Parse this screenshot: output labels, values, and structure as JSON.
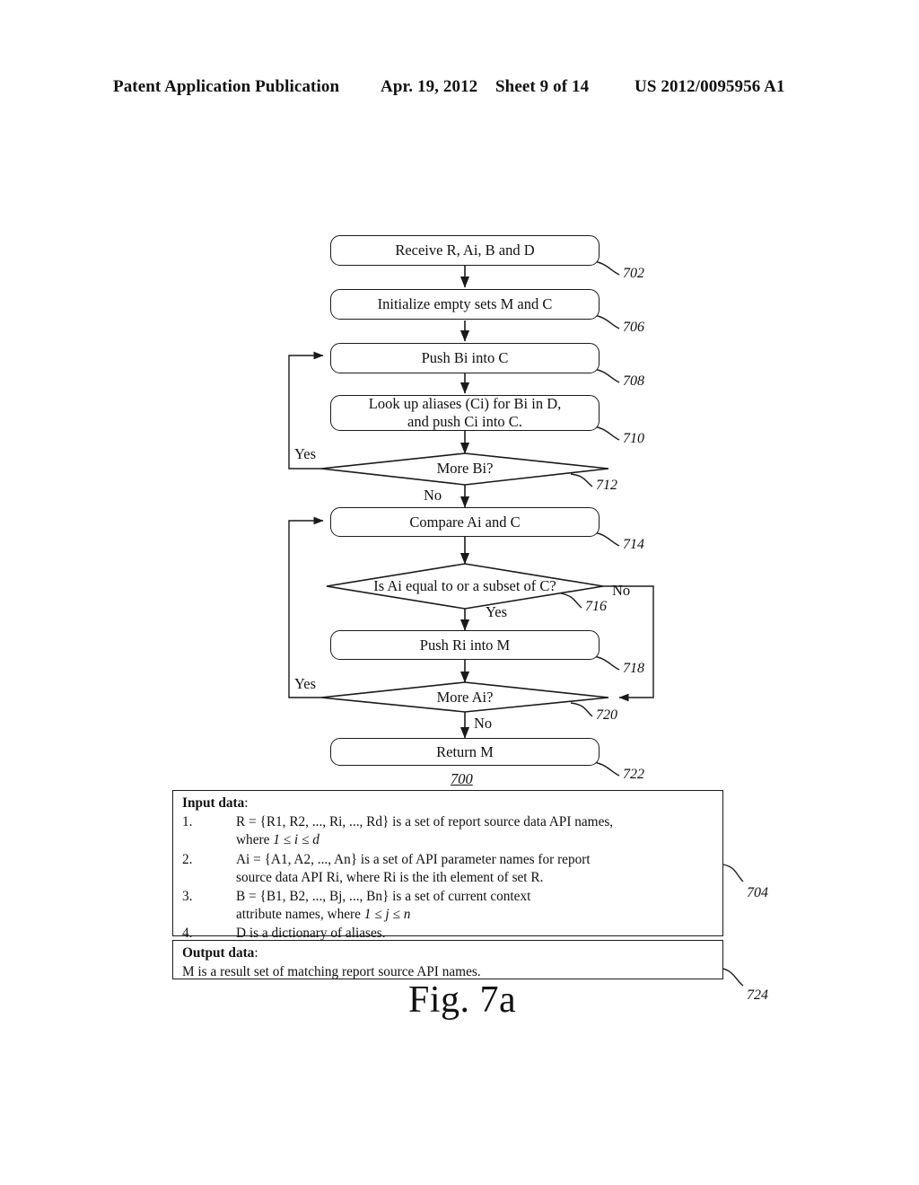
{
  "header": {
    "publication": "Patent Application Publication",
    "date": "Apr. 19, 2012",
    "sheet": "Sheet 9 of 14",
    "patent_number": "US 2012/0095956 A1"
  },
  "figure": {
    "caption": "Fig. 7a",
    "diagram_number": "700"
  },
  "flow": {
    "nodes": [
      {
        "id": "702",
        "label": "Receive R, Ai, B and D",
        "ref": "702",
        "shape": "process"
      },
      {
        "id": "706",
        "label": "Initialize empty sets M and C",
        "ref": "706",
        "shape": "process"
      },
      {
        "id": "708",
        "label": "Push Bi into C",
        "ref": "708",
        "shape": "process"
      },
      {
        "id": "710",
        "line1": "Look up aliases (Ci) for Bi in D,",
        "line2": "and push Ci into C.",
        "ref": "710",
        "shape": "process"
      },
      {
        "id": "712",
        "label": "More Bi?",
        "ref": "712",
        "shape": "decision"
      },
      {
        "id": "714",
        "label": "Compare Ai and C",
        "ref": "714",
        "shape": "process"
      },
      {
        "id": "716",
        "label": "Is Ai equal to or a subset of C?",
        "ref": "716",
        "shape": "decision"
      },
      {
        "id": "718",
        "label": "Push Ri into M",
        "ref": "718",
        "shape": "process"
      },
      {
        "id": "720",
        "label": "More Ai?",
        "ref": "720",
        "shape": "decision"
      },
      {
        "id": "722",
        "label": "Return M",
        "ref": "722",
        "shape": "process"
      }
    ],
    "edge_labels": {
      "more_bi_yes": "Yes",
      "more_bi_no": "No",
      "subset_yes": "Yes",
      "subset_no": "No",
      "more_ai_yes": "Yes",
      "more_ai_no": "No"
    }
  },
  "input_data": {
    "title": "Input data",
    "colon": ":",
    "ref": "704",
    "items": [
      {
        "marker": "1.",
        "line1": "R = {R1, R2, ..., Ri, ..., Rd} is a set of report source data API names,",
        "line2_prefix": "where ",
        "line2_math": "1 ≤ i ≤ d"
      },
      {
        "marker": "2.",
        "line1": "Ai = {A1, A2, ..., An} is a set of API parameter names for report",
        "line2_prefix": "source data API Ri, where Ri is the ith element of set R.",
        "line2_math": ""
      },
      {
        "marker": "3.",
        "line1": "B = {B1, B2, ..., Bj, ..., Bn} is a set of current context",
        "line2_prefix": "attribute names, where ",
        "line2_math": "1 ≤ j ≤ n"
      },
      {
        "marker": "4.",
        "line1": "D is a dictionary of aliases.",
        "line2_prefix": "",
        "line2_math": ""
      }
    ]
  },
  "output_data": {
    "title": "Output data",
    "colon": ":",
    "text": "M is a result set of matching report source API names.",
    "ref": "724"
  }
}
